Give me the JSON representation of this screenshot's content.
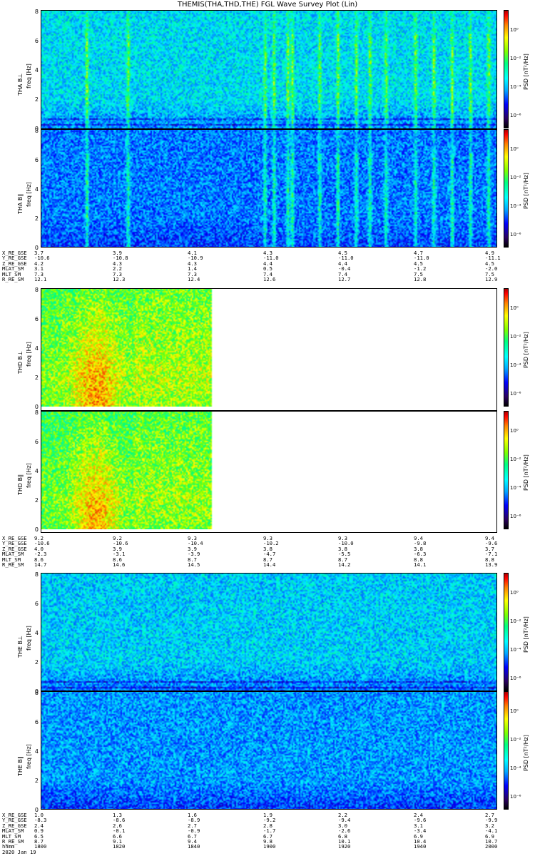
{
  "title": "THEMIS(THA,THD,THE) FGL Wave Survey Plot (Lin)",
  "colorbar": {
    "label": "PSD [nT²/Hz]",
    "ticks": [
      "10⁰",
      "10⁻²",
      "10⁻⁴",
      "10⁻⁶"
    ],
    "colors": [
      "#000000",
      "#0000ff",
      "#00ffff",
      "#00ff80",
      "#ffff00",
      "#ff0000"
    ]
  },
  "freq_ticks": [
    "0",
    "2",
    "4",
    "6",
    "8"
  ],
  "chart_data": [
    {
      "type": "heatmap",
      "probe": "THA",
      "panels": [
        {
          "label": "THA B⊥",
          "ylabel": "freq [Hz]",
          "ylim": [
            0,
            8
          ],
          "coverage_fraction": 1.0
        },
        {
          "label": "THA B∥",
          "ylabel": "freq [Hz]",
          "ylim": [
            0,
            8
          ],
          "coverage_fraction": 1.0
        }
      ],
      "ephemeris": {
        "labels": [
          "X_RE_GSE",
          "Y_RE_GSE",
          "Z_RE_GSE",
          "MLAT_SM",
          "MLT_SM",
          "R_RE_SM"
        ],
        "columns": [
          [
            "3.7",
            "-10.6",
            "4.2",
            "3.1",
            "7.3",
            "12.1"
          ],
          [
            "3.9",
            "-10.8",
            "4.3",
            "2.2",
            "7.3",
            "12.3"
          ],
          [
            "4.1",
            "-10.9",
            "4.3",
            "1.4",
            "7.3",
            "12.4"
          ],
          [
            "4.3",
            "-11.0",
            "4.4",
            "0.5",
            "7.4",
            "12.6"
          ],
          [
            "4.5",
            "-11.0",
            "4.4",
            "-0.4",
            "7.4",
            "12.7"
          ],
          [
            "4.7",
            "-11.0",
            "4.5",
            "-1.2",
            "7.5",
            "12.8"
          ],
          [
            "4.9",
            "-11.1",
            "4.5",
            "-2.0",
            "7.5",
            "12.9"
          ]
        ]
      }
    },
    {
      "type": "heatmap",
      "probe": "THD",
      "panels": [
        {
          "label": "THD B⊥",
          "ylabel": "freq [Hz]",
          "ylim": [
            0,
            8
          ],
          "coverage_fraction": 0.375
        },
        {
          "label": "THD B∥",
          "ylabel": "freq [Hz]",
          "ylim": [
            0,
            8
          ],
          "coverage_fraction": 0.375
        }
      ],
      "ephemeris": {
        "labels": [
          "X_RE_GSE",
          "Y_RE_GSE",
          "Z_RE_GSE",
          "MLAT_SM",
          "MLT_SM",
          "R_RE_SM"
        ],
        "columns": [
          [
            "9.2",
            "-10.6",
            "4.0",
            "-2.3",
            "8.6",
            "14.7"
          ],
          [
            "9.2",
            "-10.6",
            "3.9",
            "-3.1",
            "8.6",
            "14.6"
          ],
          [
            "9.3",
            "-10.4",
            "3.9",
            "-3.9",
            "8.7",
            "14.5"
          ],
          [
            "9.3",
            "-10.2",
            "3.8",
            "-4.7",
            "8.7",
            "14.4"
          ],
          [
            "9.3",
            "-10.0",
            "3.8",
            "-5.5",
            "8.7",
            "14.2"
          ],
          [
            "9.4",
            "-9.8",
            "3.8",
            "-6.3",
            "8.8",
            "14.1"
          ],
          [
            "9.4",
            "-9.6",
            "3.7",
            "-7.1",
            "8.8",
            "13.9"
          ]
        ]
      }
    },
    {
      "type": "heatmap",
      "probe": "THE",
      "panels": [
        {
          "label": "THE B⊥",
          "ylabel": "freq [Hz]",
          "ylim": [
            0,
            8
          ],
          "coverage_fraction": 1.0
        },
        {
          "label": "THE B∥",
          "ylabel": "freq [Hz]",
          "ylim": [
            0,
            8
          ],
          "coverage_fraction": 1.0
        }
      ],
      "ephemeris": {
        "labels": [
          "X_RE_GSE",
          "Y_RE_GSE",
          "Z_RE_GSE",
          "MLAT_SM",
          "MLT_SM",
          "R_RE_SM",
          "hhmm",
          "2020 Jan 19"
        ],
        "columns": [
          [
            "1.0",
            "-8.3",
            "2.4",
            "0.9",
            "6.5",
            "8.7",
            "1800"
          ],
          [
            "1.3",
            "-8.6",
            "2.6",
            "-0.1",
            "6.6",
            "9.1",
            "1820"
          ],
          [
            "1.6",
            "-8.9",
            "2.7",
            "-0.9",
            "6.7",
            "9.4",
            "1840"
          ],
          [
            "1.9",
            "-9.2",
            "2.8",
            "-1.7",
            "6.7",
            "9.8",
            "1900"
          ],
          [
            "2.2",
            "-9.4",
            "3.0",
            "-2.6",
            "6.8",
            "10.1",
            "1920"
          ],
          [
            "2.4",
            "-9.6",
            "3.1",
            "-3.4",
            "6.9",
            "10.4",
            "1940"
          ],
          [
            "2.7",
            "-9.9",
            "3.2",
            "-4.1",
            "6.9",
            "10.7",
            "2000"
          ]
        ]
      }
    }
  ]
}
